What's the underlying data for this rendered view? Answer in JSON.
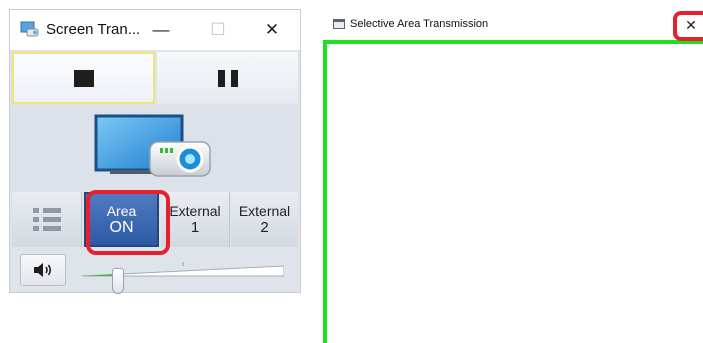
{
  "app": {
    "title": "Screen Tran...",
    "window_controls": {
      "minimize": "—",
      "maximize": "☐",
      "close": "✕"
    },
    "controls": {
      "stop_icon": "stop-icon",
      "pause_icon": "pause-icon"
    },
    "modes": [
      {
        "line1": "",
        "line2": "",
        "icon": "list-icon"
      },
      {
        "line1": "Area",
        "line2": "ON",
        "active": true
      },
      {
        "line1": "External",
        "line2": "1"
      },
      {
        "line1": "External",
        "line2": "2"
      }
    ],
    "volume": {
      "icon": "speaker-icon",
      "level": 0.18
    }
  },
  "selective": {
    "title": "Selective Area Transmission",
    "close": "✕"
  },
  "colors": {
    "highlight": "#e8202e",
    "area_on": "#3a66b0",
    "frame": "#1ee21e",
    "slider_fill": "#2fbf2f"
  }
}
